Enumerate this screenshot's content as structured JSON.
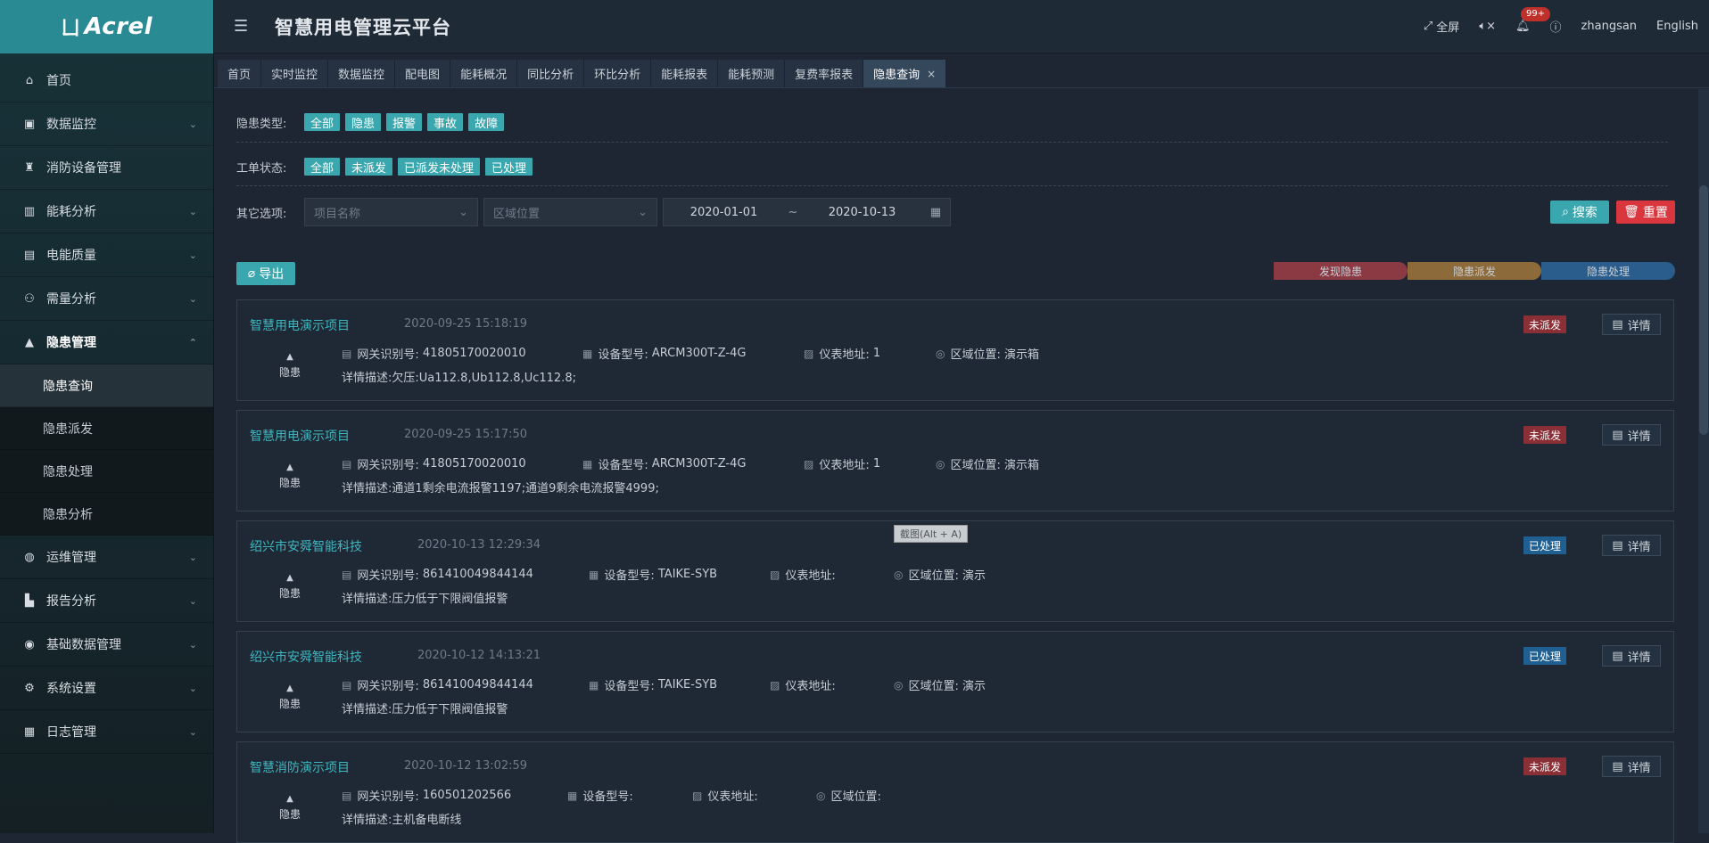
{
  "logo": {
    "mark": "ㄩ",
    "text": "Acrel"
  },
  "header": {
    "title": "智慧用电管理云平台",
    "fullscreen": "全屏",
    "mute_icon": "mute-icon",
    "badge": "99+",
    "user": "zhangsan",
    "language": "English"
  },
  "sidebar": {
    "items": [
      {
        "label": "首页",
        "icon": "home-icon"
      },
      {
        "label": "数据监控",
        "icon": "monitor-icon"
      },
      {
        "label": "消防设备管理",
        "icon": "fire-icon"
      },
      {
        "label": "能耗分析",
        "icon": "chart-icon"
      },
      {
        "label": "电能质量",
        "icon": "quality-icon"
      },
      {
        "label": "需量分析",
        "icon": "demand-icon"
      },
      {
        "label": "隐患管理",
        "icon": "warning-icon"
      },
      {
        "label": "运维管理",
        "icon": "globe-icon"
      },
      {
        "label": "报告分析",
        "icon": "report-icon"
      },
      {
        "label": "基础数据管理",
        "icon": "database-icon"
      },
      {
        "label": "系统设置",
        "icon": "settings-icon"
      },
      {
        "label": "日志管理",
        "icon": "log-icon"
      }
    ],
    "submenu": [
      {
        "label": "隐患查询",
        "active": true
      },
      {
        "label": "隐患派发"
      },
      {
        "label": "隐患处理"
      },
      {
        "label": "隐患分析"
      }
    ]
  },
  "tabs": [
    {
      "label": "首页"
    },
    {
      "label": "实时监控"
    },
    {
      "label": "数据监控"
    },
    {
      "label": "配电图"
    },
    {
      "label": "能耗概况"
    },
    {
      "label": "同比分析"
    },
    {
      "label": "环比分析"
    },
    {
      "label": "能耗报表"
    },
    {
      "label": "能耗预测"
    },
    {
      "label": "复费率报表"
    },
    {
      "label": "隐患查询",
      "active": true
    }
  ],
  "filters": {
    "type_label": "隐患类型:",
    "types": [
      "全部",
      "隐患",
      "报警",
      "事故",
      "故障"
    ],
    "status_label": "工单状态:",
    "statuses": [
      "全部",
      "未派发",
      "已派发未处理",
      "已处理"
    ],
    "other_label": "其它选项:",
    "project_placeholder": "项目名称",
    "area_placeholder": "区域位置",
    "date_start": "2020-01-01",
    "date_sep": "~",
    "date_end": "2020-10-13",
    "search": "搜索",
    "reset": "重置",
    "export": "导出"
  },
  "steps": [
    "发现隐患",
    "隐患派发",
    "隐患处理"
  ],
  "labels": {
    "gateway": "网关识别号:",
    "device": "设备型号:",
    "meter": "仪表地址:",
    "area": "区域位置:",
    "detail": "详情",
    "kind": "隐患"
  },
  "records": [
    {
      "project": "智慧用电演示项目",
      "time": "2020-09-25 15:18:19",
      "gateway": "41805170020010",
      "device": "ARCM300T-Z-4G",
      "meter": "1",
      "area": "演示箱",
      "desc": "详情描述:欠压:Ua112.8,Ub112.8,Uc112.8;",
      "status": "未派发",
      "status_color": "red"
    },
    {
      "project": "智慧用电演示项目",
      "time": "2020-09-25 15:17:50",
      "gateway": "41805170020010",
      "device": "ARCM300T-Z-4G",
      "meter": "1",
      "area": "演示箱",
      "desc": "详情描述:通道1剩余电流报警1197;通道9剩余电流报警4999;",
      "status": "未派发",
      "status_color": "red"
    },
    {
      "project": "绍兴市安舜智能科技",
      "time": "2020-10-13 12:29:34",
      "gateway": "861410049844144",
      "device": "TAIKE-SYB",
      "meter": "",
      "area": "演示",
      "desc": "详情描述:压力低于下限阀值报警",
      "status": "已处理",
      "status_color": "blue"
    },
    {
      "project": "绍兴市安舜智能科技",
      "time": "2020-10-12 14:13:21",
      "gateway": "861410049844144",
      "device": "TAIKE-SYB",
      "meter": "",
      "area": "演示",
      "desc": "详情描述:压力低于下限阀值报警",
      "status": "已处理",
      "status_color": "blue"
    },
    {
      "project": "智慧消防演示项目",
      "time": "2020-10-12 13:02:59",
      "gateway": "160501202566",
      "device": "",
      "meter": "",
      "area": "",
      "desc": "详情描述:主机备电断线",
      "status": "未派发",
      "status_color": "red"
    }
  ],
  "tooltip": "截图(Alt + A)"
}
